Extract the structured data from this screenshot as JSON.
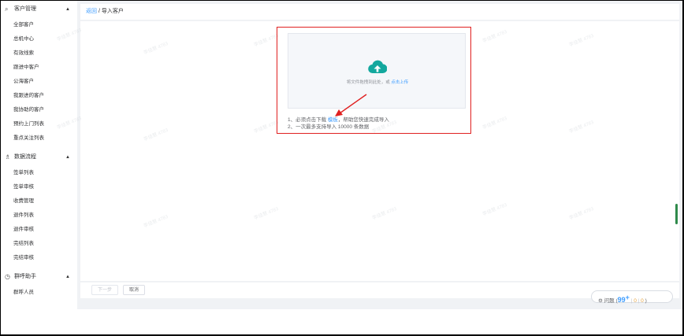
{
  "sidebar": {
    "groups": [
      {
        "icon": "customer-icon",
        "glyph": "⌕",
        "title": "客户管理",
        "arrow": "▲",
        "items": [
          "全部客户",
          "总机中心",
          "有效线索",
          "跟进中客户",
          "公海客户",
          "我跟进的客户",
          "我协助的客户",
          "预约上门列表",
          "重点关注列表"
        ]
      },
      {
        "icon": "flow-icon",
        "glyph": "♗",
        "title": "数据流程",
        "arrow": "▲",
        "items": [
          "签单列表",
          "签单审核",
          "收费管理",
          "退件列表",
          "退件审核",
          "完结列表",
          "完结审核"
        ]
      },
      {
        "icon": "call-assistant-icon",
        "glyph": "◷",
        "title": "群呼助手",
        "arrow": "▲",
        "items": [
          "群呼人员"
        ]
      }
    ]
  },
  "breadcrumb": {
    "back": "返回",
    "sep": " / ",
    "current": "导入客户"
  },
  "upload": {
    "text": "将文件拖拽到此处，或 ",
    "link": "点击上传"
  },
  "tips": {
    "line1_prefix": "1、必须点击下载 ",
    "line1_link": "模板",
    "line1_suffix": "，帮助您快速完成导入",
    "line2": "2、一次最多支持导入 10000 条数据"
  },
  "footer": {
    "next": "下一步",
    "cancel": "取消"
  },
  "badge": {
    "label": "问题 (",
    "count": "99",
    "plus": "+",
    "sep1": " | ",
    "v2": "0",
    "sep2": " | ",
    "v3": "0",
    "close": " )"
  },
  "watermark": "李佳慧 4783",
  "colors": {
    "accent": "#409eff",
    "cloud": "#13a89e",
    "highlight": "#e02020",
    "warning": "#e6a23c"
  }
}
